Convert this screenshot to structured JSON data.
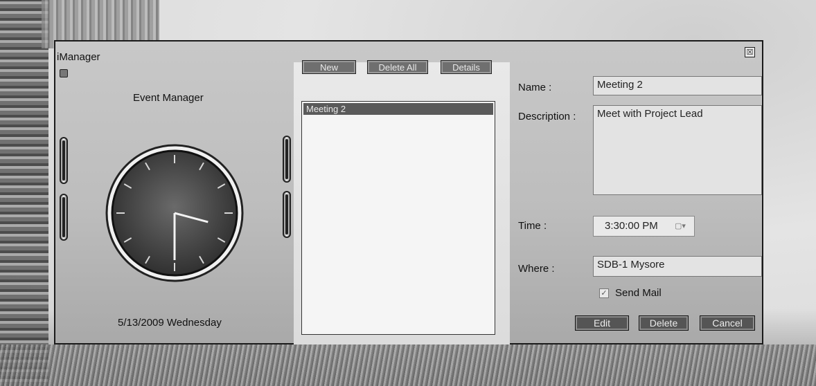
{
  "window": {
    "title": "iManager",
    "close_glyph": "☒"
  },
  "left": {
    "heading": "Event Manager",
    "date": "5/13/2009 Wednesday",
    "clock_time": "3:30"
  },
  "toolbar": {
    "new_label": "New",
    "delete_all_label": "Delete All",
    "details_label": "Details"
  },
  "events": [
    {
      "label": "Meeting 2"
    }
  ],
  "form": {
    "name_label": "Name :",
    "name_value": "Meeting 2",
    "description_label": "Description :",
    "description_value": "Meet with Project Lead",
    "time_label": "Time :",
    "time_value": "3:30:00 PM",
    "where_label": "Where :",
    "where_value": "SDB-1 Mysore",
    "send_mail_label": "Send Mail",
    "send_mail_checked": true
  },
  "actions": {
    "edit_label": "Edit",
    "delete_label": "Delete",
    "cancel_label": "Cancel"
  },
  "icons": {
    "clock": "analog-clock-icon",
    "dropdown": "chevron-down-icon"
  }
}
